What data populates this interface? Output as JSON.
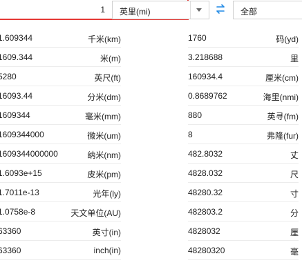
{
  "converter": {
    "quantity": "1",
    "from_unit": "英里(mi)",
    "filter": "全部",
    "accent_border": "#e53935",
    "swap_color": "#1e88e5"
  },
  "left_results": [
    {
      "value": "1.609344",
      "unit": "千米(km)"
    },
    {
      "value": "1609.344",
      "unit": "米(m)"
    },
    {
      "value": "5280",
      "unit": "英尺(ft)"
    },
    {
      "value": "16093.44",
      "unit": "分米(dm)"
    },
    {
      "value": "1609344",
      "unit": "毫米(mm)"
    },
    {
      "value": "1609344000",
      "unit": "微米(um)"
    },
    {
      "value": "1609344000000",
      "unit": "纳米(nm)"
    },
    {
      "value": "1.6093e+15",
      "unit": "皮米(pm)"
    },
    {
      "value": "1.7011e-13",
      "unit": "光年(ly)"
    },
    {
      "value": "1.0758e-8",
      "unit": "天文单位(AU)"
    },
    {
      "value": "63360",
      "unit": "英寸(in)"
    },
    {
      "value": "63360",
      "unit": "inch(in)"
    }
  ],
  "right_results": [
    {
      "value": "1760",
      "unit": "码(yd)"
    },
    {
      "value": "3.218688",
      "unit": "里"
    },
    {
      "value": "160934.4",
      "unit": "厘米(cm)"
    },
    {
      "value": "0.8689762",
      "unit": "海里(nmi)"
    },
    {
      "value": "880",
      "unit": "英寻(fm)"
    },
    {
      "value": "8",
      "unit": "弗隆(fur)"
    },
    {
      "value": "482.8032",
      "unit": "丈"
    },
    {
      "value": "4828.032",
      "unit": "尺"
    },
    {
      "value": "48280.32",
      "unit": "寸"
    },
    {
      "value": "482803.2",
      "unit": "分"
    },
    {
      "value": "4828032",
      "unit": "厘"
    },
    {
      "value": "48280320",
      "unit": "毫"
    }
  ]
}
